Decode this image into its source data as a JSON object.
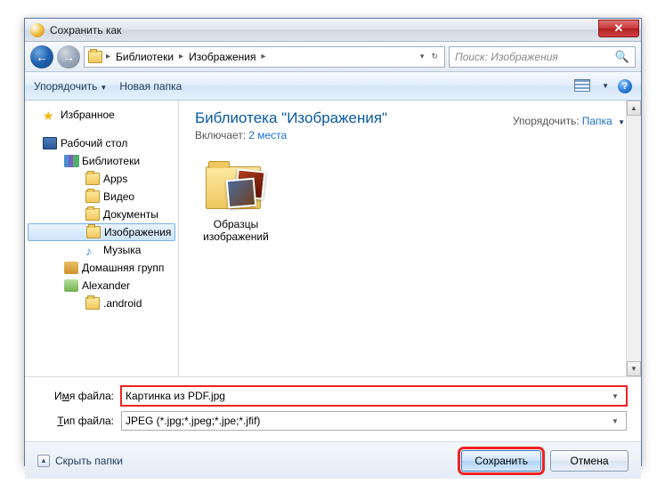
{
  "titlebar": {
    "title": "Сохранить как"
  },
  "breadcrumb": {
    "seg1": "Библиотеки",
    "seg2": "Изображения"
  },
  "search": {
    "placeholder": "Поиск: Изображения"
  },
  "toolbar": {
    "organize": "Упорядочить",
    "newfolder": "Новая папка"
  },
  "sidebar": {
    "favorites": "Избранное",
    "desktop": "Рабочий стол",
    "libraries": "Библиотеки",
    "apps": "Apps",
    "video": "Видео",
    "documents": "Документы",
    "pictures": "Изображения",
    "music": "Музыка",
    "homegroup": "Домашняя групп",
    "user": "Alexander",
    "android": ".android"
  },
  "main": {
    "title": "Библиотека \"Изображения\"",
    "includes_label": "Включает:",
    "includes_link": "2 места",
    "sort_label": "Упорядочить:",
    "sort_value": "Папка",
    "item1_l1": "Образцы",
    "item1_l2": "изображений"
  },
  "fields": {
    "filename_label_pre": "И",
    "filename_label_u": "м",
    "filename_label_post": "я файла:",
    "filetype_label_pre": "",
    "filetype_label_u": "Т",
    "filetype_label_post": "ип файла:",
    "filename_value": "Картинка из PDF.jpg",
    "filetype_value": "JPEG (*.jpg;*.jpeg;*.jpe;*.jfif)"
  },
  "footer": {
    "hide": "Скрыть папки",
    "save": "Сохранить",
    "cancel": "Отмена"
  }
}
